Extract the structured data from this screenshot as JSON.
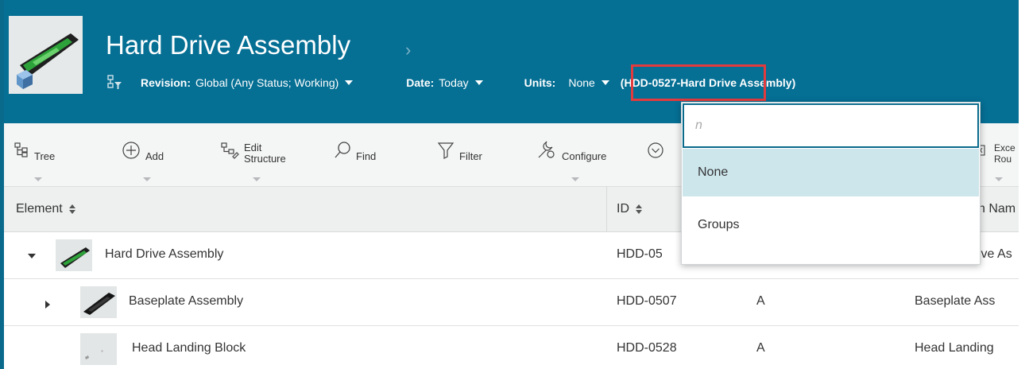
{
  "header": {
    "title": "Hard Drive Assembly",
    "title_chevron": "›",
    "revision_label": "Revision:",
    "revision_value": "Global (Any Status; Working)",
    "date_label": "Date:",
    "date_value": "Today",
    "units_label": "Units:",
    "units_value": "None",
    "reference": "(HDD-0527-Hard Drive Assembly)"
  },
  "toolbar": {
    "tree": "Tree",
    "add": "Add",
    "edit_structure_line1": "Edit",
    "edit_structure_line2": "Structure",
    "find": "Find",
    "filter": "Filter",
    "configure": "Configure",
    "excel_partial_line1": "Exce",
    "excel_partial_line2": "Rou"
  },
  "grid": {
    "columns": [
      "Element",
      "ID",
      "n Nam"
    ],
    "rows": [
      {
        "element": "Hard Drive Assembly",
        "id": "HDD-05",
        "rev": "",
        "name": "ive As",
        "expanded": true
      },
      {
        "element": "Baseplate Assembly",
        "id": "HDD-0507",
        "rev": "A",
        "name": "Baseplate Ass",
        "expanded": false
      },
      {
        "element": "Head Landing Block",
        "id": "HDD-0528",
        "rev": "A",
        "name": "Head Landing",
        "expanded": null
      }
    ]
  },
  "units_dropdown": {
    "search_value": "n",
    "options": [
      "None",
      "Groups"
    ],
    "selected": "None"
  },
  "colors": {
    "header_bg": "#056f94",
    "highlight_border": "#e23b3e",
    "selected_option_bg": "#cde6ec",
    "input_border": "#0a6a8c"
  }
}
